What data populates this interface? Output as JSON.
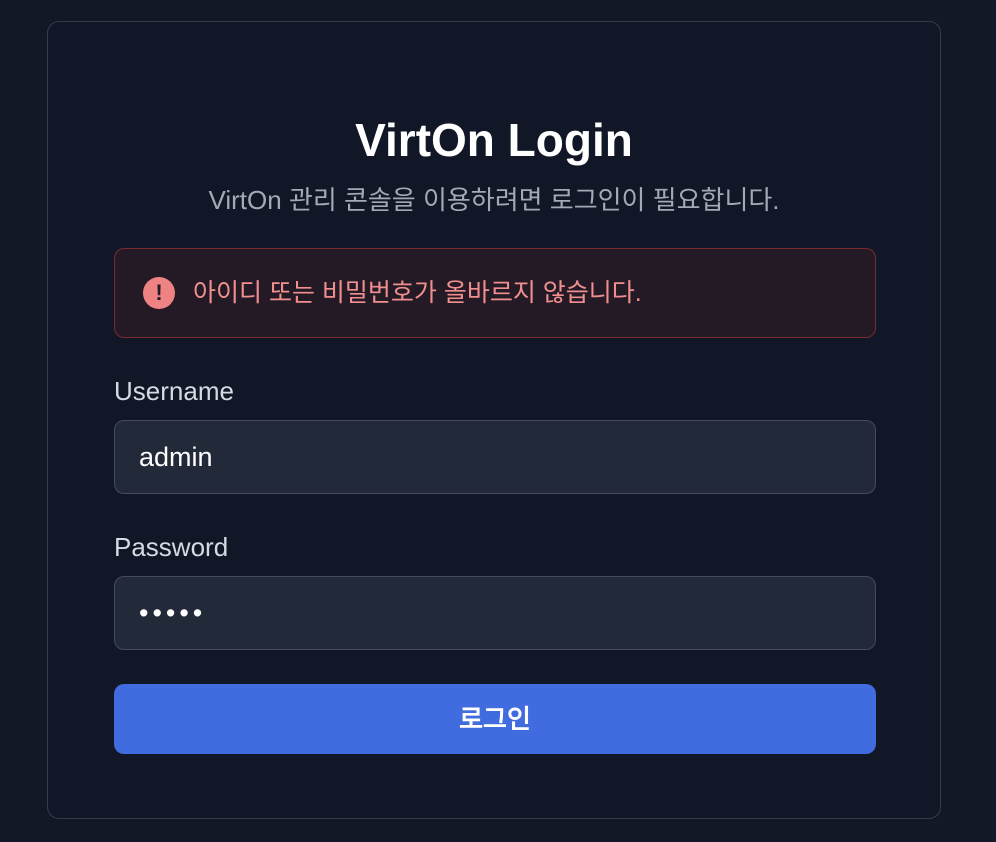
{
  "login": {
    "title": "VirtOn Login",
    "subtitle": "VirtOn 관리 콘솔을 이용하려면 로그인이 필요합니다.",
    "error": {
      "icon": "alert-circle-icon",
      "message": "아이디 또는 비밀번호가 올바르지 않습니다."
    },
    "username": {
      "label": "Username",
      "value": "admin"
    },
    "password": {
      "label": "Password",
      "value": "•••••"
    },
    "submit_label": "로그인"
  },
  "colors": {
    "background": "#131826",
    "card": "#111727",
    "accent": "#416ce0",
    "error": "#ef8383"
  }
}
